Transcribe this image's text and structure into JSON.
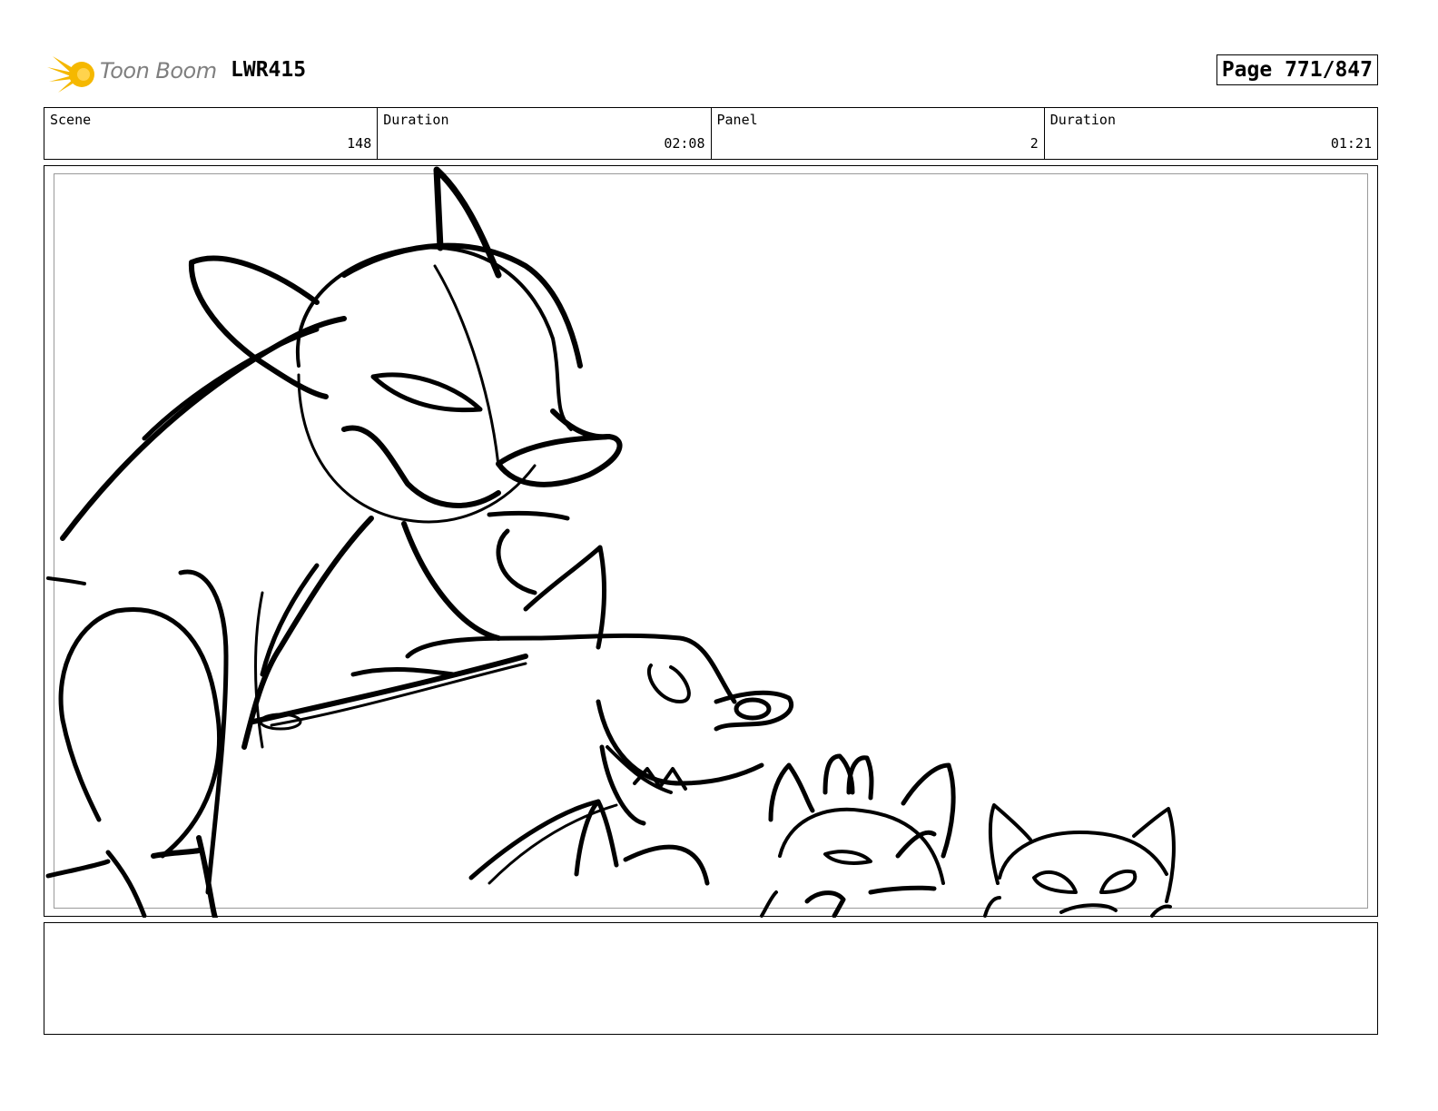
{
  "header": {
    "logo_text": "Toon Boom",
    "project_code": "LWR415",
    "page_label": "Page 771/847"
  },
  "info": {
    "scene_label": "Scene",
    "scene_value": "148",
    "scene_duration_label": "Duration",
    "scene_duration_value": "02:08",
    "panel_label": "Panel",
    "panel_value": "2",
    "panel_duration_label": "Duration",
    "panel_duration_value": "01:21"
  },
  "colors": {
    "logo_accent": "#f5b800",
    "logo_text": "#7f7f7f",
    "frame_inner": "#9a9a9a"
  },
  "icons": {
    "logo": "starburst-icon"
  },
  "notes": {
    "text": ""
  }
}
